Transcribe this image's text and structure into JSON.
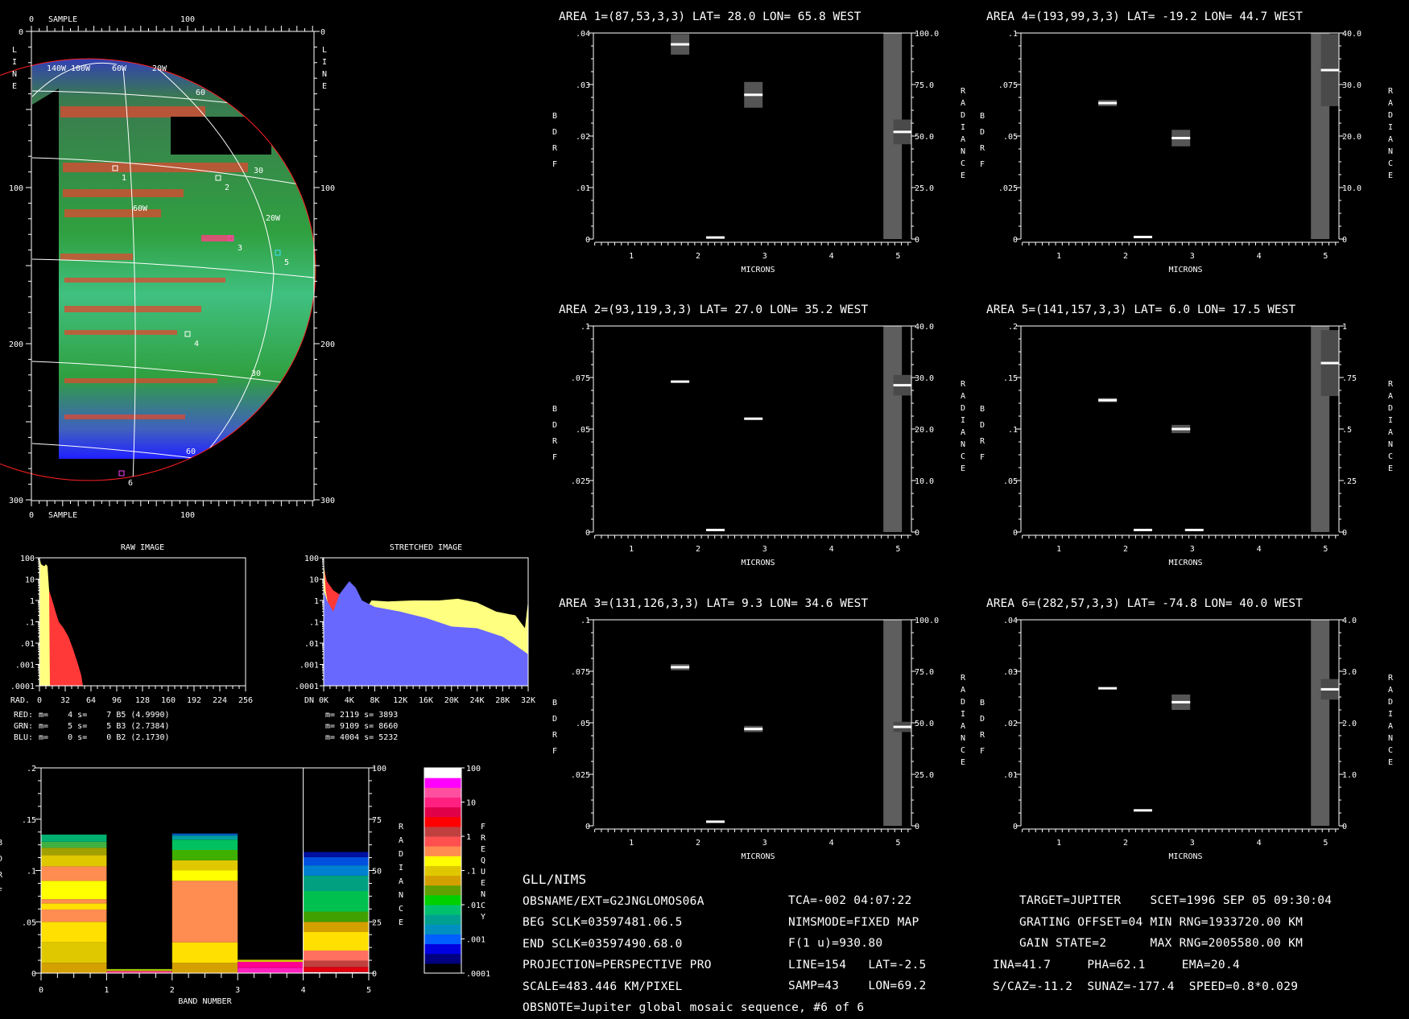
{
  "image_panel": {
    "sample_label": "SAMPLE",
    "line_label": "LINE",
    "sample_ticks": [
      "0",
      "100"
    ],
    "line_ticks": [
      "0",
      "100",
      "200",
      "300"
    ],
    "grid_labels": [
      "140W",
      "100W",
      "60W",
      "20W",
      "60",
      "30",
      "60W",
      "20W",
      "30",
      "60"
    ],
    "area_markers": [
      "1",
      "2",
      "3",
      "4",
      "5",
      "6"
    ]
  },
  "histograms": {
    "raw": {
      "title": "RAW IMAGE",
      "axis_label": "RAD.",
      "x_ticks": [
        "0",
        "32",
        "64",
        "96",
        "128",
        "160",
        "192",
        "224",
        "256"
      ],
      "y_ticks": [
        "100",
        "10",
        "1",
        ".1",
        ".01",
        ".001",
        ".0001"
      ],
      "series": {
        "red": [
          [
            0,
            40
          ],
          [
            4,
            30
          ],
          [
            8,
            10
          ],
          [
            12,
            3
          ],
          [
            16,
            1
          ],
          [
            20,
            0.3
          ],
          [
            24,
            0.1
          ],
          [
            30,
            0.05
          ],
          [
            36,
            0.02
          ],
          [
            42,
            0.005
          ],
          [
            48,
            0.001
          ],
          [
            52,
            0.0003
          ],
          [
            54,
            0.0001
          ]
        ],
        "yellow": [
          [
            0,
            100
          ],
          [
            2,
            50
          ],
          [
            6,
            40
          ],
          [
            8,
            50
          ],
          [
            10,
            40
          ],
          [
            12,
            3
          ],
          [
            13,
            0.0001
          ]
        ]
      },
      "stats": [
        {
          "channel": "RED:",
          "text": " m=    4 s=    7 B5 (4.9990)",
          "color": "#ff3030"
        },
        {
          "channel": "GRN:",
          "text": " m=    5 s=    5 B3 (2.7384)",
          "color": "#ffff80"
        },
        {
          "channel": "BLU:",
          "text": " m=    0 s=    0 B2 (2.1730)",
          "color": "#6060ff"
        }
      ]
    },
    "stretched": {
      "title": "STRETCHED IMAGE",
      "axis_label": "DN",
      "x_ticks": [
        "0K",
        "4K",
        "8K",
        "12K",
        "16K",
        "20K",
        "24K",
        "28K",
        "32K"
      ],
      "y_ticks": [
        "100",
        "10",
        "1",
        ".1",
        ".01",
        ".001",
        ".0001"
      ],
      "series": {
        "yellow": [
          [
            0,
            100
          ],
          [
            0.3,
            3
          ],
          [
            1,
            0.2
          ],
          [
            3,
            0.15
          ],
          [
            5,
            0.3
          ],
          [
            7,
            0.6
          ],
          [
            7.5,
            1
          ],
          [
            10,
            0.9
          ],
          [
            14,
            1
          ],
          [
            18,
            1
          ],
          [
            21,
            1.2
          ],
          [
            24,
            0.8
          ],
          [
            27,
            0.3
          ],
          [
            30,
            0.2
          ],
          [
            31.5,
            0.05
          ],
          [
            32,
            1
          ]
        ],
        "blue": [
          [
            0,
            3
          ],
          [
            0.5,
            1
          ],
          [
            1.5,
            0.3
          ],
          [
            2.5,
            2
          ],
          [
            4,
            8
          ],
          [
            5,
            4
          ],
          [
            6,
            1
          ],
          [
            8,
            0.5
          ],
          [
            12,
            0.3
          ],
          [
            16,
            0.15
          ],
          [
            20,
            0.06
          ],
          [
            24,
            0.05
          ],
          [
            28,
            0.02
          ],
          [
            30,
            0.008
          ],
          [
            32,
            0.003
          ]
        ],
        "red": [
          [
            0,
            40
          ],
          [
            0.5,
            8
          ],
          [
            1.5,
            3
          ],
          [
            3,
            1.5
          ],
          [
            5,
            1
          ],
          [
            7,
            0.5
          ],
          [
            10,
            0.25
          ],
          [
            14,
            0.1
          ],
          [
            18,
            0.05
          ],
          [
            22,
            0.02
          ],
          [
            26,
            0.01
          ],
          [
            29,
            0.005
          ],
          [
            32,
            0.002
          ]
        ]
      },
      "stats": [
        "m= 2119 s= 3893",
        "m= 9109 s= 8660",
        "m= 4004 s= 5232"
      ]
    }
  },
  "band_chart": {
    "xlabel": "BAND NUMBER",
    "ylabel": "BDRF",
    "right_label": "RADIANCE",
    "x_ticks": [
      "0",
      "1",
      "2",
      "3",
      "4",
      "5"
    ],
    "y_ticks": [
      "0",
      ".05",
      ".1",
      ".15",
      ".2"
    ],
    "r_ticks": [
      "0",
      "25",
      "50",
      "75",
      "100"
    ],
    "ylim": [
      0,
      0.2
    ],
    "bands": [
      {
        "top": 0.135,
        "stripes": [
          [
            0,
            0.01,
            "#d4a000"
          ],
          [
            0.01,
            0.03,
            "#e0c800"
          ],
          [
            0.03,
            0.05,
            "#ffe000"
          ],
          [
            0.05,
            0.062,
            "#ff8c50"
          ],
          [
            0.062,
            0.068,
            "#ffe000"
          ],
          [
            0.068,
            0.072,
            "#ff8c50"
          ],
          [
            0.072,
            0.09,
            "#ffff00"
          ],
          [
            0.09,
            0.104,
            "#ff8c50"
          ],
          [
            0.104,
            0.115,
            "#e0c800"
          ],
          [
            0.115,
            0.122,
            "#a0a000"
          ],
          [
            0.122,
            0.128,
            "#40b040"
          ],
          [
            0.128,
            0.135,
            "#00b070"
          ]
        ]
      },
      {
        "top": 0.004,
        "stripes": [
          [
            0,
            0.002,
            "#ff2080"
          ],
          [
            0.002,
            0.004,
            "#a0c000"
          ]
        ]
      },
      {
        "top": 0.136,
        "stripes": [
          [
            0,
            0.01,
            "#d4a000"
          ],
          [
            0.01,
            0.03,
            "#ffe000"
          ],
          [
            0.03,
            0.09,
            "#ff8c50"
          ],
          [
            0.09,
            0.1,
            "#ffff00"
          ],
          [
            0.1,
            0.11,
            "#e0c800"
          ],
          [
            0.11,
            0.12,
            "#40b000"
          ],
          [
            0.12,
            0.13,
            "#00c060"
          ],
          [
            0.13,
            0.134,
            "#00a0a0"
          ],
          [
            0.134,
            0.136,
            "#0060c0"
          ]
        ]
      },
      {
        "top": 0.013,
        "stripes": [
          [
            0,
            0.005,
            "#ff20c0"
          ],
          [
            0.005,
            0.011,
            "#ff0090"
          ],
          [
            0.011,
            0.013,
            "#d0d000"
          ]
        ]
      },
      {
        "top": 0.118,
        "stripes": [
          [
            0,
            0.001,
            "#ffffff"
          ],
          [
            0.001,
            0.006,
            "#e00010"
          ],
          [
            0.006,
            0.012,
            "#c04040"
          ],
          [
            0.012,
            0.022,
            "#ff7060"
          ],
          [
            0.022,
            0.04,
            "#ffe000"
          ],
          [
            0.04,
            0.05,
            "#d4a000"
          ],
          [
            0.05,
            0.06,
            "#40a000"
          ],
          [
            0.06,
            0.08,
            "#00c050"
          ],
          [
            0.08,
            0.095,
            "#00a080"
          ],
          [
            0.095,
            0.105,
            "#0080d0"
          ],
          [
            0.105,
            0.113,
            "#0050e0"
          ],
          [
            0.113,
            0.118,
            "#0010a0"
          ]
        ]
      }
    ]
  },
  "colorbar": {
    "label": "FREQUENCY",
    "ticks": [
      "100",
      "10",
      "1",
      ".1",
      ".01",
      ".001",
      ".0001"
    ],
    "colors": [
      "#000000",
      "#000080",
      "#0000e0",
      "#0060ff",
      "#0090c0",
      "#00a090",
      "#00c070",
      "#00d000",
      "#60a000",
      "#d4a000",
      "#e0c800",
      "#ffff00",
      "#ff8c50",
      "#ff5050",
      "#c04040",
      "#ff0000",
      "#e0004a",
      "#ff2080",
      "#ff50a0",
      "#ff00ff",
      "#ffffff"
    ]
  },
  "area_plots": [
    {
      "title": "AREA 1=(87,53,3,3) LAT=  28.0 LON=  65.8 WEST",
      "ymax": 0.04,
      "rmax": 100,
      "y_ticks": [
        "0",
        ".01",
        ".02",
        ".03",
        ".04"
      ],
      "r_ticks": [
        "0",
        "25.0",
        "50.0",
        "75.0",
        "100.0"
      ],
      "bdrf": [
        [
          1.73,
          0.0378,
          0.002
        ],
        [
          2.26,
          0.0003,
          0
        ],
        [
          2.83,
          0.028,
          0.0025
        ]
      ],
      "radiance": [
        5.05,
        52,
        6
      ]
    },
    {
      "title": "AREA 2=(93,119,3,3) LAT=  27.0 LON=  35.2 WEST",
      "ymax": 0.1,
      "rmax": 40,
      "y_ticks": [
        "0",
        ".025",
        ".05",
        ".075",
        ".1"
      ],
      "r_ticks": [
        "0",
        "10.0",
        "20.0",
        "30.0",
        "40.0"
      ],
      "bdrf": [
        [
          1.73,
          0.073,
          0
        ],
        [
          2.26,
          0.001,
          0
        ],
        [
          2.83,
          0.055,
          0
        ]
      ],
      "radiance": [
        5.05,
        28.5,
        2
      ]
    },
    {
      "title": "AREA 3=(131,126,3,3) LAT=   9.3 LON=  34.6 WEST",
      "ymax": 0.1,
      "rmax": 100,
      "y_ticks": [
        "0",
        ".025",
        ".05",
        ".075",
        ".1"
      ],
      "r_ticks": [
        "0",
        "25.0",
        "50.0",
        "75.0",
        "100.0"
      ],
      "bdrf": [
        [
          1.73,
          0.077,
          0.0015
        ],
        [
          2.26,
          0.002,
          0
        ],
        [
          2.83,
          0.047,
          0.0015
        ]
      ],
      "radiance": [
        5.05,
        48,
        2.5
      ]
    },
    {
      "title": "AREA 4=(193,99,3,3) LAT= -19.2 LON=  44.7 WEST",
      "ymax": 0.1,
      "rmax": 40,
      "y_ticks": [
        "0",
        ".025",
        ".05",
        ".075",
        ".1"
      ],
      "r_ticks": [
        "0",
        "10.0",
        "20.0",
        "30.0",
        "40.0"
      ],
      "bdrf": [
        [
          1.73,
          0.066,
          0.0015
        ],
        [
          2.26,
          0.001,
          0
        ],
        [
          2.83,
          0.049,
          0.004
        ]
      ],
      "radiance": [
        5.05,
        32.8,
        7
      ]
    },
    {
      "title": "AREA 5=(141,157,3,3) LAT=   6.0 LON=  17.5 WEST",
      "ymax": 0.2,
      "rmax": 1,
      "y_ticks": [
        "0",
        ".05",
        ".1",
        ".15",
        ".2"
      ],
      "r_ticks": [
        "0",
        ".25",
        ".5",
        ".75",
        "1"
      ],
      "bdrf": [
        [
          1.73,
          0.128,
          0.002
        ],
        [
          2.26,
          0.002,
          0
        ],
        [
          2.83,
          0.1,
          0.004
        ],
        [
          3.03,
          0.002,
          0
        ]
      ],
      "radiance": [
        5.05,
        0.82,
        0.16
      ]
    },
    {
      "title": "AREA 6=(282,57,3,3) LAT= -74.8 LON=  40.0 WEST",
      "ymax": 0.04,
      "rmax": 4,
      "y_ticks": [
        "0",
        ".01",
        ".02",
        ".03",
        ".04"
      ],
      "r_ticks": [
        "0",
        "1.0",
        "2.0",
        "3.0",
        "4.0"
      ],
      "bdrf": [
        [
          1.73,
          0.0267,
          0
        ],
        [
          2.26,
          0.003,
          0
        ],
        [
          2.83,
          0.024,
          0.0015
        ]
      ],
      "radiance": [
        5.05,
        2.65,
        0.2
      ]
    }
  ],
  "area_axis": {
    "xlabel": "MICRONS",
    "ylabel": "BDRF",
    "rlabel": "RADIANCE",
    "x_ticks": [
      "1",
      "2",
      "3",
      "4",
      "5"
    ]
  },
  "info": {
    "left": [
      "GLL/NIMS",
      "OBSNAME/EXT=G2JNGLOMOS06A",
      "BEG SCLK=03597481.06.5",
      "END SCLK=03597490.68.0",
      "PROJECTION=PERSPECTIVE PRO",
      "SCALE=483.446 KM/PIXEL",
      "OBSNOTE=Jupiter global mosaic sequence, #6 of 6"
    ],
    "mid": [
      "TCA=-002 04:07:22",
      "NIMSMODE=FIXED MAP",
      "F(1 u)=930.80",
      "LINE=154   LAT=-2.5",
      "SAMP=43    LON=69.2"
    ],
    "right": [
      "TARGET=JUPITER    SCET=1996 SEP 05 09:30:04",
      "GRATING OFFSET=04 MIN RNG=1933720.00 KM",
      "GAIN STATE=2      MAX RNG=2005580.00 KM"
    ],
    "angles": [
      "INA=41.7     PHA=62.1     EMA=20.4",
      "S/CAZ=-11.2  SUNAZ=-177.4  SPEED=0.8*0.029"
    ]
  }
}
